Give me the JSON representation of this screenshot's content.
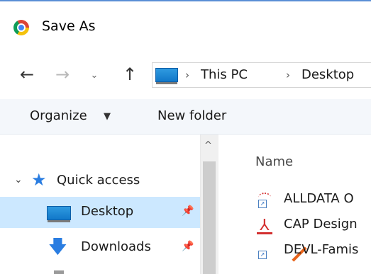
{
  "window": {
    "title": "Save As",
    "app_icon": "chrome-icon"
  },
  "address": {
    "back_icon": "←",
    "forward_icon": "→",
    "recent_icon": "⌄",
    "up_icon": "↑",
    "separator": "›",
    "crumbs": [
      "This PC",
      "Desktop"
    ]
  },
  "toolbar": {
    "organize_label": "Organize",
    "organize_arrow": "▼",
    "new_folder_label": "New folder"
  },
  "nav": {
    "scroll_up_icon": "^",
    "quick_access": {
      "chevron": "⌄",
      "label": "Quick access"
    },
    "items": [
      {
        "label": "Desktop",
        "pinned": true,
        "selected": true
      },
      {
        "label": "Downloads",
        "pinned": true,
        "selected": false
      }
    ]
  },
  "files": {
    "column_name": "Name",
    "rows": [
      {
        "label": "ALLDATA O",
        "icon": "shortcut-icon"
      },
      {
        "label": "CAP Design",
        "icon": "pdf-icon"
      },
      {
        "label": "DEVL-Famis",
        "icon": "shortcut-pencil-icon"
      }
    ]
  },
  "colors": {
    "accent": "#2a7de1",
    "selection": "#cce8ff",
    "toolbar_bg": "#f4f7fb",
    "title_border": "#5a8fd6"
  }
}
